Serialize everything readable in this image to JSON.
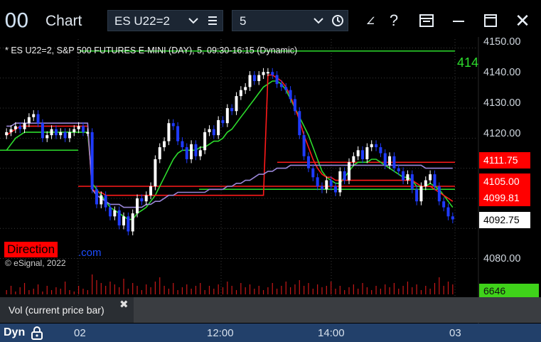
{
  "window": {
    "app_icon": "00",
    "title": "Chart",
    "symbol": "ES U22=2",
    "interval": "5"
  },
  "toolbar": {
    "icons": [
      "chevron-down-icon",
      "list-icon",
      "clock-icon",
      "draw-icon",
      "help-icon",
      "panel-icon",
      "minimize-icon",
      "maximize-icon",
      "close-icon"
    ],
    "draw_glyph": "∠",
    "help_glyph": "?",
    "close_glyph": "✕"
  },
  "chart": {
    "header": "* ES U22=2, S&P 500 FUTURES E-MINI (DAY), 5, 09:30-16:15 (Dynamic)",
    "direction_label": "Direction",
    "watermark_suffix": ".com",
    "copyright": "© eSignal, 2022",
    "green_line_peek": "414",
    "price_axis": [
      "4150.00",
      "4140.00",
      "4130.00",
      "4120.00",
      "4080.00"
    ],
    "badges": {
      "red_upper": "4111.75",
      "red_mid": "4105.00",
      "red_lower": "4099.81",
      "last_price": "4092.75"
    },
    "colors": {
      "up_candle": "#ffffff",
      "down_candle": "#1f3bff",
      "ma_green": "#2ddc2d",
      "ma_red": "#ff1a1a",
      "ma_purple": "#9a86d8",
      "vol_bar": "#c81818"
    }
  },
  "volume": {
    "legend": "Vol (current price bar)",
    "close_glyph": "✖",
    "value": "6646"
  },
  "time_axis": {
    "mode": "Dyn",
    "labels": [
      "02",
      "12:00",
      "14:00",
      "03"
    ]
  },
  "chart_data": {
    "type": "candlestick",
    "title": "* ES U22=2, S&P 500 FUTURES E-MINI (DAY), 5, 09:30-16:15 (Dynamic)",
    "x_ticks": [
      "02",
      "12:00",
      "14:00",
      "03"
    ],
    "y_ticks": [
      "4150.00",
      "4140.00",
      "4130.00",
      "4120.00",
      "4080.00"
    ],
    "ylim": [
      4078,
      4152
    ],
    "closes": [
      4122,
      4123,
      4124,
      4123,
      4125,
      4127,
      4128,
      4125,
      4120,
      4121,
      4123,
      4121,
      4122,
      4120,
      4122,
      4123,
      4124,
      4122,
      4122,
      4103,
      4098,
      4101,
      4097,
      4094,
      4096,
      4091,
      4094,
      4089,
      4095,
      4100,
      4099,
      4101,
      4104,
      4113,
      4117,
      4119,
      4125,
      4124,
      4119,
      4117,
      4113,
      4118,
      4114,
      4116,
      4122,
      4123,
      4121,
      4126,
      4125,
      4130,
      4129,
      4134,
      4136,
      4137,
      4141,
      4139,
      4141,
      4142,
      4142,
      4141,
      4138,
      4137,
      4136,
      4133,
      4129,
      4121,
      4114,
      4110,
      4107,
      4104,
      4103,
      4106,
      4104,
      4102,
      4109,
      4106,
      4112,
      4114,
      4116,
      4113,
      4117,
      4118,
      4117,
      4115,
      4111,
      4114,
      4110,
      4109,
      4106,
      4108,
      4103,
      4099,
      4104,
      4106,
      4108,
      4104,
      4099,
      4097,
      4094,
      4093
    ],
    "series": [
      {
        "color": "#2ddc2d",
        "values": [
          4116,
          4118,
          4120,
          4121,
          4122,
          4122,
          4122,
          4122,
          4122,
          4122,
          4122,
          4122,
          4122,
          4122,
          4122,
          4122,
          4122,
          4122,
          4122,
          4105,
          4103,
          4101,
          4099,
          4097,
          4096,
          4095,
          4094,
          4093,
          4093,
          4095,
          4096,
          4097,
          4099,
          4101,
          4104,
          4107,
          4110,
          4113,
          4115,
          4116,
          4116,
          4116,
          4116,
          4117,
          4117,
          4118,
          4119,
          4119,
          4120,
          4122,
          4123,
          4125,
          4127,
          4129,
          4131,
          4133,
          4135,
          4137,
          4138,
          4139,
          4139,
          4138,
          4136,
          4133,
          4130,
          4127,
          4124,
          4121,
          4117,
          4113,
          4109,
          4107,
          4106,
          4105,
          4105,
          4107,
          4109,
          4111,
          4112,
          4112,
          4112,
          4113,
          4113,
          4112,
          4111,
          4110,
          4109,
          4108,
          4107,
          4107,
          4106,
          4104,
          4104,
          4104,
          4105,
          4104,
          4103,
          4101,
          4099,
          4097
        ]
      },
      {
        "color": "#ff1a1a",
        "values": [
          4121,
          4122,
          4123,
          4124,
          4124,
          4124,
          4124,
          4124,
          4124,
          4124,
          4124,
          4124,
          4124,
          4124,
          4124,
          4124,
          4124,
          4124,
          4124,
          4103,
          4102,
          4102,
          4101,
          4101,
          4101,
          4101,
          4101,
          4101,
          4101,
          4101,
          4101,
          4101,
          4101,
          4101,
          4101,
          4101,
          4101,
          4101,
          4101,
          4101,
          4101,
          4101,
          4101,
          4101,
          4101,
          4101,
          4101,
          4101,
          4101,
          4101,
          4101,
          4101,
          4101,
          4101,
          4101,
          4101,
          4101,
          4101,
          4141,
          4141,
          4140,
          4139,
          4137,
          4134,
          4130,
          4126,
          4121,
          4117,
          4113,
          4110,
          4108,
          4107,
          4107,
          4106,
          4106,
          4106,
          4106,
          4106,
          4106,
          4106,
          4106,
          4106,
          4106,
          4106,
          4106,
          4106,
          4106,
          4106,
          4106,
          4106,
          4106,
          4105,
          4104,
          4104,
          4104,
          4103,
          4102,
          4101,
          4100,
          4099
        ]
      },
      {
        "color": "#9a86d8",
        "values": [
          4124,
          4124,
          4125,
          4125,
          4125,
          4125,
          4125,
          4125,
          4125,
          4125,
          4125,
          4125,
          4125,
          4125,
          4125,
          4125,
          4125,
          4125,
          4125,
          4103,
          4101,
          4100,
          4099,
          4098,
          4098,
          4098,
          4097,
          4097,
          4097,
          4097,
          4097,
          4098,
          4098,
          4099,
          4099,
          4100,
          4101,
          4101,
          4102,
          4102,
          4102,
          4102,
          4102,
          4102,
          4102,
          4103,
          4103,
          4103,
          4103,
          4104,
          4104,
          4105,
          4105,
          4106,
          4106,
          4107,
          4108,
          4108,
          4109,
          4109,
          4110,
          4110,
          4110,
          4111,
          4111,
          4111,
          4111,
          4111,
          4111,
          4111,
          4111,
          4111,
          4111,
          4111,
          4111,
          4111,
          4111,
          4111,
          4111,
          4111,
          4111,
          4111,
          4111,
          4111,
          4111,
          4111,
          4111,
          4111,
          4111,
          4111,
          4111,
          4111,
          4111,
          4110,
          4110,
          4110,
          4110,
          4110,
          4110,
          4110
        ]
      }
    ],
    "horizontal_lines": [
      4149,
      4112,
      4104,
      4103
    ],
    "volume": [
      3,
      6,
      2,
      5,
      8,
      3,
      4,
      7,
      2,
      6,
      3,
      5,
      4,
      9,
      3,
      2,
      6,
      4,
      3,
      14,
      10,
      8,
      6,
      9,
      7,
      5,
      11,
      4,
      8,
      6,
      3,
      7,
      5,
      9,
      12,
      6,
      4,
      8,
      3,
      5,
      7,
      4,
      6,
      8,
      3,
      6,
      4,
      7,
      5,
      9,
      6,
      3,
      8,
      5,
      7,
      4,
      6,
      3,
      5,
      8,
      4,
      6,
      9,
      5,
      7,
      10,
      6,
      8,
      4,
      7,
      5,
      6,
      9,
      4,
      6,
      3,
      5,
      7,
      4,
      8,
      5,
      3,
      6,
      4,
      7,
      5,
      8,
      4,
      6,
      9,
      5,
      7,
      3,
      6,
      4,
      8,
      12,
      6,
      9,
      7
    ]
  }
}
